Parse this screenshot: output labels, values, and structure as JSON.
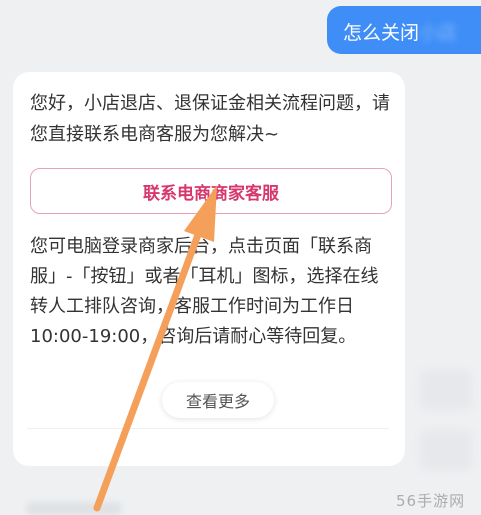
{
  "user_message": {
    "text": "怎么关闭",
    "blurred_text": "小店"
  },
  "reply": {
    "greeting": "您好，小店退店、退保证金相关流程问题，请您直接联系电商客服为您解决~",
    "contact_button_label": "联系电商商家客服",
    "detail": "您可电脑登录商家后台，点击页面「联系商服」-「按钮」或者「耳机」图标，选择在线转人工排队咨询，客服工作时间为工作日10:00-19:00，咨询后请耐心等待回复。",
    "see_more_label": "查看更多"
  },
  "watermark": "56手游网",
  "colors": {
    "user_bubble": "#3f8ef8",
    "accent": "#d6386c",
    "annotation_arrow": "#f5a05a"
  },
  "icons": {
    "annotation": "arrow-pointing-icon"
  }
}
